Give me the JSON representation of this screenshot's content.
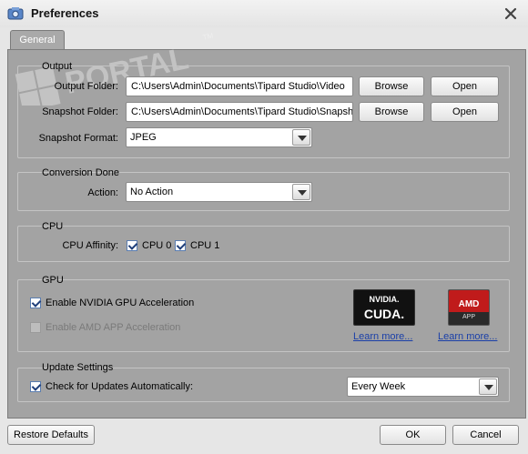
{
  "window": {
    "title": "Preferences"
  },
  "tabs": [
    {
      "label": "General"
    }
  ],
  "watermark": {
    "text": "PORTAL",
    "tm": "TM"
  },
  "output": {
    "group_title": "Output",
    "output_folder_label": "Output Folder:",
    "output_folder_value": "C:\\Users\\Admin\\Documents\\Tipard Studio\\Video",
    "snapshot_folder_label": "Snapshot Folder:",
    "snapshot_folder_value": "C:\\Users\\Admin\\Documents\\Tipard Studio\\Snapsh",
    "snapshot_format_label": "Snapshot Format:",
    "snapshot_format_value": "JPEG",
    "browse_label": "Browse",
    "open_label": "Open"
  },
  "conversion": {
    "group_title": "Conversion Done",
    "action_label": "Action:",
    "action_value": "No Action"
  },
  "cpu": {
    "group_title": "CPU",
    "affinity_label": "CPU Affinity:",
    "cpu0_label": "CPU 0",
    "cpu0_checked": true,
    "cpu1_label": "CPU 1",
    "cpu1_checked": true
  },
  "gpu": {
    "group_title": "GPU",
    "nvidia_label": "Enable NVIDIA GPU Acceleration",
    "nvidia_checked": true,
    "amd_label": "Enable AMD APP Acceleration",
    "amd_checked": false,
    "nvidia_badge_top": "NVIDIA.",
    "nvidia_badge_bottom": "CUDA.",
    "amd_badge_top": "AMD",
    "amd_badge_bottom": "APP",
    "learn_more_nvidia": "Learn more...",
    "learn_more_amd": "Learn more..."
  },
  "update": {
    "group_title": "Update Settings",
    "check_label": "Check for Updates Automatically:",
    "check_checked": true,
    "frequency_value": "Every Week"
  },
  "footer": {
    "restore_label": "Restore Defaults",
    "ok_label": "OK",
    "cancel_label": "Cancel"
  },
  "colors": {
    "panel": "#a3a3a3",
    "link": "#1a3fa8",
    "amd_red": "#c01b1b"
  }
}
